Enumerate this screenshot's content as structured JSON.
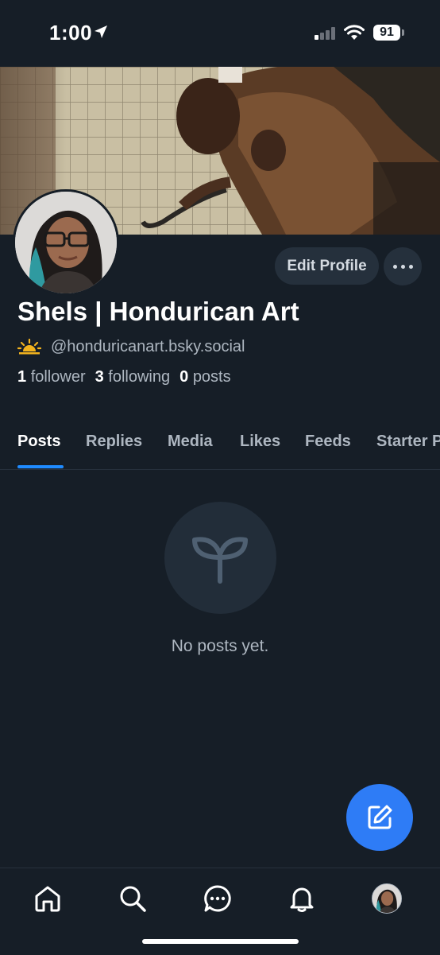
{
  "status_bar": {
    "time": "1:00",
    "battery": "91"
  },
  "profile": {
    "display_name": "Shels | Hondurican Art",
    "handle": "@honduricanart.bsky.social",
    "followers_count": "1",
    "followers_label": "follower",
    "following_count": "3",
    "following_label": "following",
    "posts_count": "0",
    "posts_label": "posts"
  },
  "actions": {
    "edit_profile_label": "Edit Profile"
  },
  "tabs": [
    {
      "label": "Posts",
      "active": true
    },
    {
      "label": "Replies",
      "active": false
    },
    {
      "label": "Media",
      "active": false
    },
    {
      "label": "Likes",
      "active": false
    },
    {
      "label": "Feeds",
      "active": false
    },
    {
      "label": "Starter Packs",
      "active": false
    }
  ],
  "feed": {
    "empty_message": "No posts yet.",
    "empty_icon": "sprout-icon"
  },
  "bottom_nav": [
    {
      "icon": "home-icon"
    },
    {
      "icon": "search-icon"
    },
    {
      "icon": "chat-icon"
    },
    {
      "icon": "bell-icon"
    },
    {
      "icon": "profile-avatar"
    }
  ],
  "colors": {
    "background": "#161e27",
    "accent": "#1f8bff",
    "fab": "#2e7cf6"
  }
}
